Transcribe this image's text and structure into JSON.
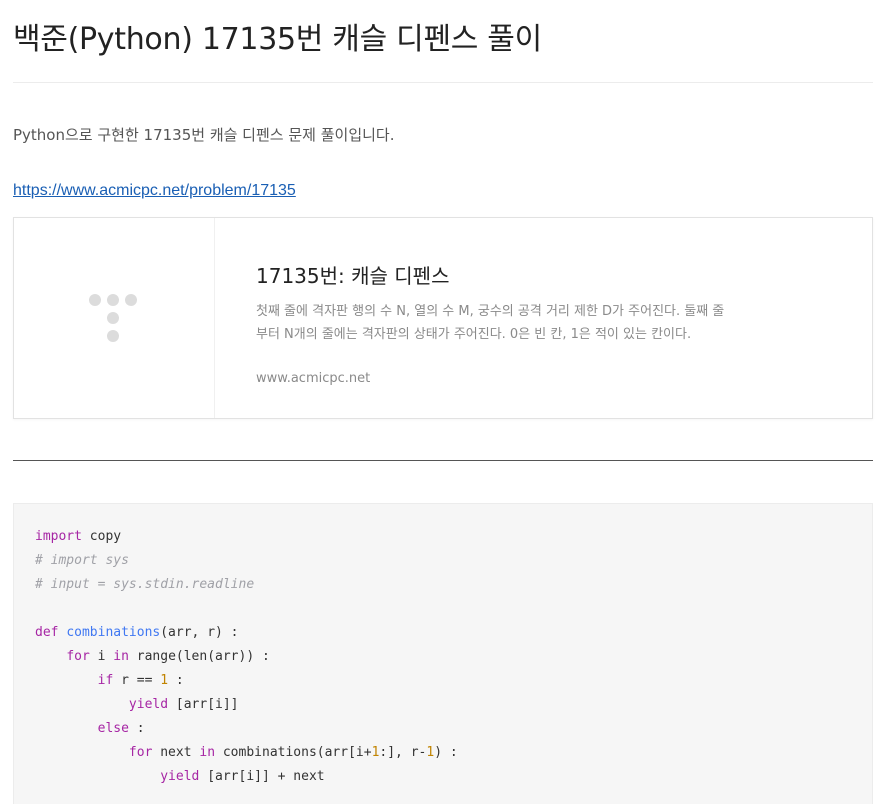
{
  "post": {
    "title": "백준(Python) 17135번 캐슬 디펜스 풀이",
    "intro": "Python으로 구현한 17135번 캐슬 디펜스 문제 풀이입니다.",
    "link": "https://www.acmicpc.net/problem/17135"
  },
  "card": {
    "title": "17135번: 캐슬 디펜스",
    "description": "첫째 줄에 격자판 행의 수 N, 열의 수 M, 궁수의 공격 거리 제한 D가 주어진다. 둘째 줄부터 N개의 줄에는 격자판의 상태가 주어진다. 0은 빈 칸, 1은 적이 있는 칸이다.",
    "domain": "www.acmicpc.net",
    "thumbnail_icon": "placeholder-dots-icon"
  },
  "code": {
    "language": "python",
    "lines": [
      [
        {
          "t": "import",
          "c": "kw"
        },
        {
          "t": " copy",
          "c": ""
        }
      ],
      [
        {
          "t": "# import sys",
          "c": "cm"
        }
      ],
      [
        {
          "t": "# input = sys.stdin.readline",
          "c": "cm"
        }
      ],
      [],
      [
        {
          "t": "def",
          "c": "kw"
        },
        {
          "t": " ",
          "c": ""
        },
        {
          "t": "combinations",
          "c": "fn"
        },
        {
          "t": "(arr, r) :",
          "c": ""
        }
      ],
      [
        {
          "t": "    ",
          "c": ""
        },
        {
          "t": "for",
          "c": "kw"
        },
        {
          "t": " i ",
          "c": ""
        },
        {
          "t": "in",
          "c": "kw"
        },
        {
          "t": " range(len(arr)) :",
          "c": ""
        }
      ],
      [
        {
          "t": "        ",
          "c": ""
        },
        {
          "t": "if",
          "c": "kw"
        },
        {
          "t": " r == ",
          "c": ""
        },
        {
          "t": "1",
          "c": "num"
        },
        {
          "t": " :",
          "c": ""
        }
      ],
      [
        {
          "t": "            ",
          "c": ""
        },
        {
          "t": "yield",
          "c": "kw"
        },
        {
          "t": " [arr[i]]",
          "c": ""
        }
      ],
      [
        {
          "t": "        ",
          "c": ""
        },
        {
          "t": "else",
          "c": "kw"
        },
        {
          "t": " :",
          "c": ""
        }
      ],
      [
        {
          "t": "            ",
          "c": ""
        },
        {
          "t": "for",
          "c": "kw"
        },
        {
          "t": " next ",
          "c": ""
        },
        {
          "t": "in",
          "c": "kw"
        },
        {
          "t": " combinations(arr[i+",
          "c": ""
        },
        {
          "t": "1",
          "c": "num"
        },
        {
          "t": ":], r-",
          "c": ""
        },
        {
          "t": "1",
          "c": "num"
        },
        {
          "t": ") :",
          "c": ""
        }
      ],
      [
        {
          "t": "                ",
          "c": ""
        },
        {
          "t": "yield",
          "c": "kw"
        },
        {
          "t": " [arr[i]] + next",
          "c": ""
        }
      ]
    ]
  }
}
